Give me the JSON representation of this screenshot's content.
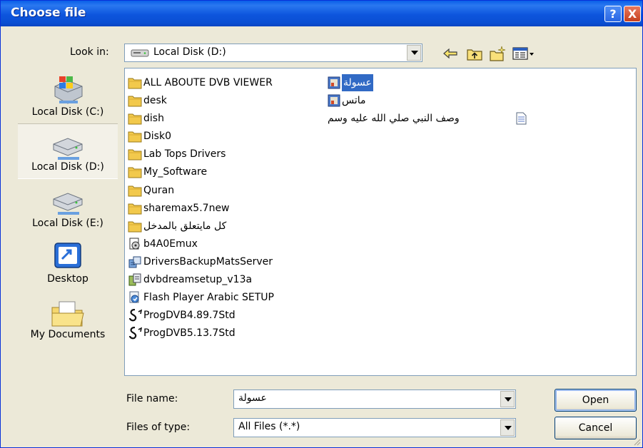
{
  "window": {
    "title": "Choose file",
    "help_label": "?",
    "close_label": "X"
  },
  "toolbar": {
    "look_in_label": "Look in:",
    "look_in_value": "Local Disk (D:)"
  },
  "places": [
    {
      "label": "Local Disk (C:)",
      "icon": "windows-drive-icon"
    },
    {
      "label": "Local Disk (D:)",
      "icon": "hard-drive-icon",
      "selected": true
    },
    {
      "label": "Local Disk (E:)",
      "icon": "hard-drive-icon"
    },
    {
      "label": "Desktop",
      "icon": "desktop-icon"
    },
    {
      "label": "My Documents",
      "icon": "my-documents-icon"
    }
  ],
  "files_col1": [
    {
      "name": "ALL ABOUTE DVB VIEWER",
      "icon": "folder-icon"
    },
    {
      "name": "desk",
      "icon": "folder-icon"
    },
    {
      "name": "dish",
      "icon": "folder-icon"
    },
    {
      "name": "Disk0",
      "icon": "folder-icon"
    },
    {
      "name": "Lab Tops Drivers",
      "icon": "folder-icon"
    },
    {
      "name": "My_Software",
      "icon": "folder-icon"
    },
    {
      "name": "Quran",
      "icon": "folder-icon"
    },
    {
      "name": "sharemax5.7new",
      "icon": "folder-icon"
    },
    {
      "name": "كل مايتعلق بالمدخل",
      "icon": "folder-icon"
    },
    {
      "name": "b4A0Emux",
      "icon": "disk-image-icon"
    },
    {
      "name": "DriversBackupMatsServer",
      "icon": "installer-icon"
    },
    {
      "name": "dvbdreamsetup_v13a",
      "icon": "installer-icon"
    },
    {
      "name": "Flash Player Arabic SETUP",
      "icon": "setup-icon"
    },
    {
      "name": "ProgDVB4.89.7Std",
      "icon": "progdvb-icon"
    },
    {
      "name": "ProgDVB5.13.7Std",
      "icon": "progdvb-icon"
    }
  ],
  "files_col2": [
    {
      "name": "عسولة",
      "icon": "image-file-icon",
      "selected": true
    },
    {
      "name": "ماتس",
      "icon": "image-file-icon"
    },
    {
      "name": "وصف النبي صلي الله عليه وسم",
      "icon": "text-file-icon"
    }
  ],
  "footer": {
    "file_name_label": "File name:",
    "file_name_value": "عسولة",
    "file_type_label": "Files of type:",
    "file_type_value": "All Files (*.*)",
    "open_label": "Open",
    "cancel_label": "Cancel"
  },
  "colors": {
    "titlebar": "#0a4fd3",
    "selection": "#316ac5",
    "folder": "#f2c94c",
    "dialog_bg": "#ece9d8"
  }
}
